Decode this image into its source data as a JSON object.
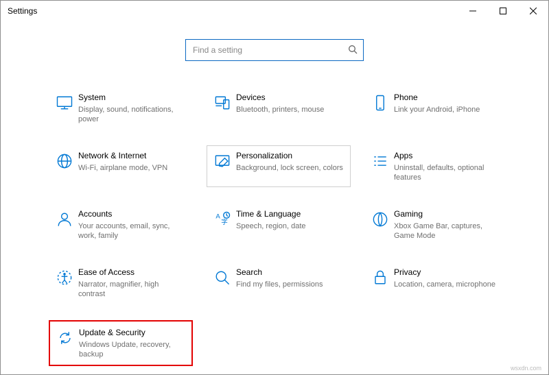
{
  "window": {
    "title": "Settings"
  },
  "search": {
    "placeholder": "Find a setting"
  },
  "tiles": [
    {
      "title": "System",
      "desc": "Display, sound, notifications, power"
    },
    {
      "title": "Devices",
      "desc": "Bluetooth, printers, mouse"
    },
    {
      "title": "Phone",
      "desc": "Link your Android, iPhone"
    },
    {
      "title": "Network & Internet",
      "desc": "Wi-Fi, airplane mode, VPN"
    },
    {
      "title": "Personalization",
      "desc": "Background, lock screen, colors"
    },
    {
      "title": "Apps",
      "desc": "Uninstall, defaults, optional features"
    },
    {
      "title": "Accounts",
      "desc": "Your accounts, email, sync, work, family"
    },
    {
      "title": "Time & Language",
      "desc": "Speech, region, date"
    },
    {
      "title": "Gaming",
      "desc": "Xbox Game Bar, captures, Game Mode"
    },
    {
      "title": "Ease of Access",
      "desc": "Narrator, magnifier, high contrast"
    },
    {
      "title": "Search",
      "desc": "Find my files, permissions"
    },
    {
      "title": "Privacy",
      "desc": "Location, camera, microphone"
    },
    {
      "title": "Update & Security",
      "desc": "Windows Update, recovery, backup"
    }
  ],
  "watermark": "wsxdn.com"
}
